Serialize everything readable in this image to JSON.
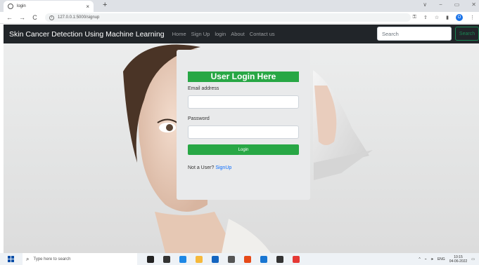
{
  "browser": {
    "tab_title": "login",
    "tab_close": "×",
    "new_tab": "+",
    "url": "127.0.0.1:5000/signup",
    "nav": {
      "back": "←",
      "forward": "→",
      "reload": "C"
    },
    "window_controls": [
      "∨",
      "−",
      "▭",
      "✕"
    ],
    "profile_initial": "O"
  },
  "navbar": {
    "brand": "Skin Cancer Detection Using Machine Learning",
    "links": [
      "Home",
      "Sign Up",
      "login",
      "About",
      "Contact us"
    ],
    "search_placeholder": "Search",
    "search_button": "Search"
  },
  "login_card": {
    "title": "User Login Here",
    "email_label": "Email address",
    "password_label": "Password",
    "login_button": "Login",
    "prompt": "Not a User?",
    "signup_link": "SignUp"
  },
  "taskbar": {
    "search_placeholder": "Type here to search",
    "icons": [
      {
        "name": "cortana-icon",
        "color": "#222222"
      },
      {
        "name": "task-view-icon",
        "color": "#333333"
      },
      {
        "name": "edge-icon",
        "color": "#1e88e5"
      },
      {
        "name": "file-explorer-icon",
        "color": "#f6b93b"
      },
      {
        "name": "store-icon",
        "color": "#1565c0"
      },
      {
        "name": "app-icon",
        "color": "#555555"
      },
      {
        "name": "office-icon",
        "color": "#e64a19"
      },
      {
        "name": "settings-icon",
        "color": "#1976d2"
      },
      {
        "name": "terminal-icon",
        "color": "#333333"
      },
      {
        "name": "chrome-icon",
        "color": "#e53935"
      }
    ],
    "tray_lang": "ENG",
    "time": "10:15",
    "date": "04-06-2022"
  }
}
